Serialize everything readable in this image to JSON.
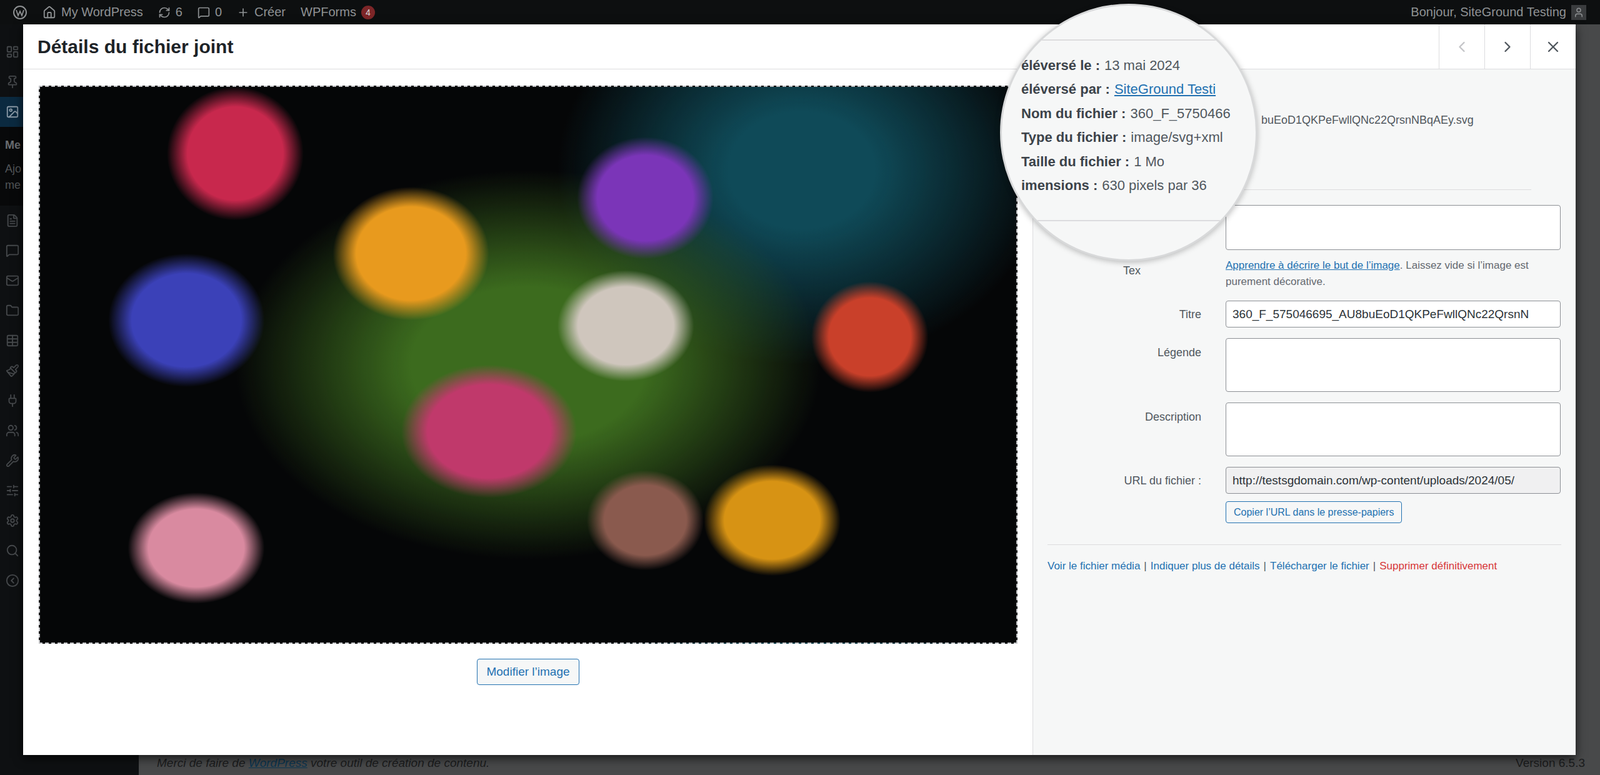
{
  "admin_bar": {
    "site": "My WordPress",
    "updates": "6",
    "comments": "0",
    "new": "Créer",
    "wpforms": "WPForms",
    "wpforms_badge": "4",
    "greeting": "Bonjour, SiteGround Testing"
  },
  "sidebar": {
    "items": [
      {
        "selected": false
      },
      {
        "selected": false
      },
      {
        "selected": true
      },
      {
        "selected": false
      },
      {
        "selected": false
      },
      {
        "selected": false
      },
      {
        "selected": false
      },
      {
        "selected": false
      },
      {
        "selected": false
      },
      {
        "selected": false
      },
      {
        "selected": false
      },
      {
        "selected": false
      },
      {
        "selected": false
      },
      {
        "selected": false
      },
      {
        "selected": false
      },
      {
        "selected": false
      }
    ],
    "submenu": [
      {
        "lines": [
          "Me"
        ],
        "selected": true
      },
      {
        "lines": [
          "Ajo",
          "me"
        ],
        "selected": false
      }
    ]
  },
  "modal": {
    "title": "Détails du fichier joint",
    "previous_disabled": true,
    "next_disabled": false
  },
  "image": {
    "edit_button": "Modifier l’image"
  },
  "details": {
    "filename_tail": "buEoD1QKPeFwllQNc22QrsnNBqAEy.svg"
  },
  "magnifier": {
    "rows": [
      {
        "label": "éléversé le :",
        "value": "13 mai 2024",
        "link": false
      },
      {
        "label": "éléversé par :",
        "value": "SiteGround Testi",
        "link": true
      },
      {
        "label": "Nom du fichier :",
        "value": "360_F_5750466",
        "link": false
      },
      {
        "label": "Type du fichier :",
        "value": "image/svg+xml",
        "link": false
      },
      {
        "label": "Taille du fichier :",
        "value": "1 Mo",
        "link": false
      },
      {
        "label": "imensions :",
        "value": "630 pixels par 36",
        "link": false
      }
    ]
  },
  "fields": [
    {
      "label": "Tex",
      "kind": "textarea",
      "value": "",
      "help_link": "Apprendre à décrire le but de l’image",
      "help_text": ". Laissez vide si l’image est purement décorative.",
      "button": ""
    },
    {
      "label": "Titre",
      "kind": "input",
      "value": "360_F_575046695_AU8buEoD1QKPeFwllQNc22QrsnN",
      "help_link": "",
      "help_text": "",
      "button": ""
    },
    {
      "label": "Légende",
      "kind": "textarea",
      "value": "",
      "help_link": "",
      "help_text": "",
      "button": ""
    },
    {
      "label": "Description",
      "kind": "textarea",
      "value": "",
      "help_link": "",
      "help_text": "",
      "button": ""
    },
    {
      "label": "URL du fichier :",
      "kind": "readonly",
      "value": "http://testsgdomain.com/wp-content/uploads/2024/05/",
      "help_link": "",
      "help_text": "",
      "button": "Copier l’URL dans le presse-papiers"
    }
  ],
  "actions": {
    "separator": "|",
    "items": [
      {
        "label": "Voir le fichier média",
        "danger": false
      },
      {
        "label": "Indiquer plus de détails",
        "danger": false
      },
      {
        "label": "Télécharger le fichier",
        "danger": false
      },
      {
        "label": "Supprimer définitivement",
        "danger": true
      }
    ]
  },
  "footer": {
    "before": "Merci de faire de ",
    "link": "WordPress",
    "after": " votre outil de création de contenu.",
    "version": "Version 6.5.3"
  }
}
